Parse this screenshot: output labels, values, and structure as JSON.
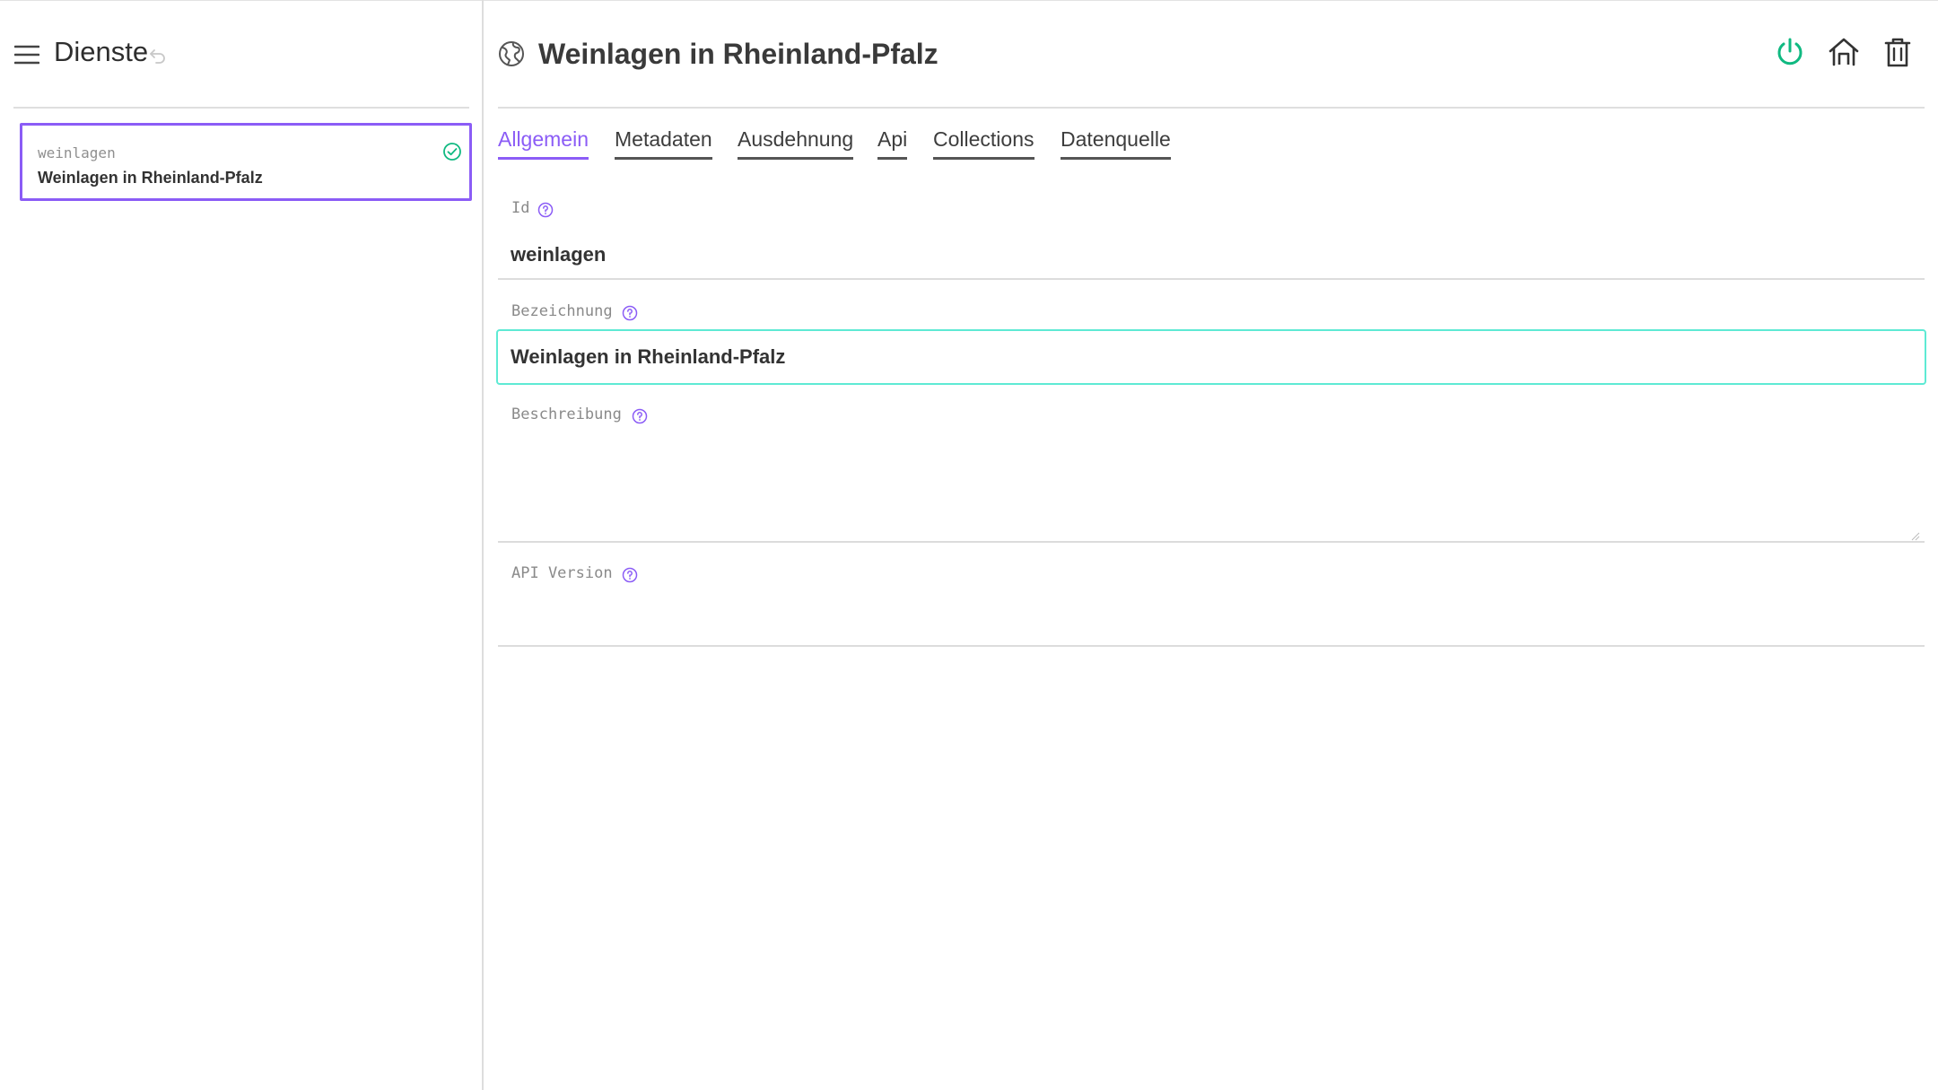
{
  "sidebar": {
    "title": "Dienste",
    "items": [
      {
        "id": "weinlagen",
        "label": "Weinlagen in Rheinland-Pfalz",
        "status": "ok"
      }
    ]
  },
  "header": {
    "title": "Weinlagen in Rheinland-Pfalz",
    "icons": [
      "globe-icon",
      "power-icon",
      "home-icon",
      "trash-icon"
    ]
  },
  "tabs": [
    {
      "label": "Allgemein",
      "active": true
    },
    {
      "label": "Metadaten",
      "active": false
    },
    {
      "label": "Ausdehnung",
      "active": false
    },
    {
      "label": "Api",
      "active": false
    },
    {
      "label": "Collections",
      "active": false
    },
    {
      "label": "Datenquelle",
      "active": false
    }
  ],
  "form": {
    "id": {
      "label": "Id",
      "value": "weinlagen"
    },
    "bezeichnung": {
      "label": "Bezeichnung",
      "value": "Weinlagen in Rheinland-Pfalz"
    },
    "beschreibung": {
      "label": "Beschreibung",
      "value": ""
    },
    "api_version": {
      "label": "API Version",
      "value": ""
    }
  },
  "colors": {
    "accent": "#8b5cf6",
    "success": "#10b981",
    "focus": "#5eead4"
  }
}
